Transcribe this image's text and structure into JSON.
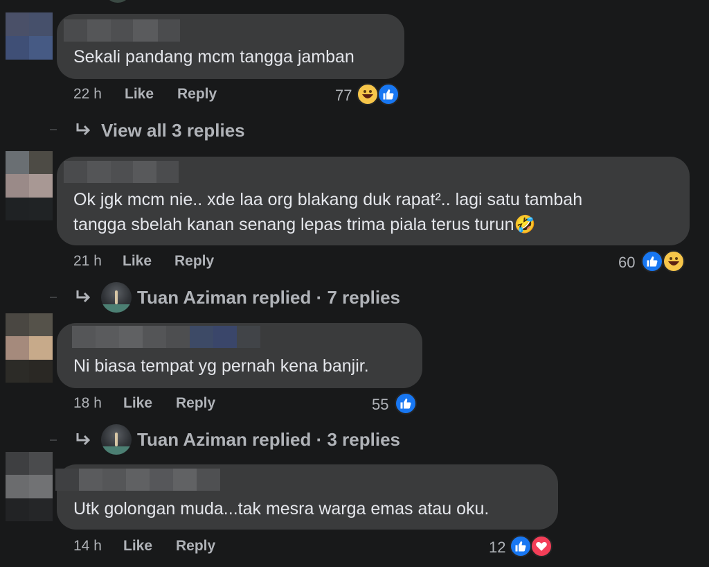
{
  "comments": [
    {
      "text_lines": [
        "Sekali pandang mcm tangga jamban"
      ],
      "time": "22 h",
      "like_label": "Like",
      "reply_label": "Reply",
      "reaction_count": "77",
      "reactions": [
        "haha",
        "like"
      ],
      "replies_text": "View all 3 replies"
    },
    {
      "text_lines": [
        "Ok jgk mcm nie.. xde laa org blakang duk rapat².. lagi satu tambah",
        "tangga sbelah kanan senang lepas trima piala terus turun🤣"
      ],
      "time": "21 h",
      "like_label": "Like",
      "reply_label": "Reply",
      "reaction_count": "60",
      "reactions": [
        "like",
        "haha"
      ],
      "replies_text": "Tuan Aziman replied · 7 replies"
    },
    {
      "text_lines": [
        "Ni biasa tempat yg pernah kena banjir."
      ],
      "time": "18 h",
      "like_label": "Like",
      "reply_label": "Reply",
      "reaction_count": "55",
      "reactions": [
        "like"
      ],
      "replies_text": "Tuan Aziman replied · 3 replies"
    },
    {
      "text_lines": [
        "Utk golongan muda...tak mesra warga emas atau oku."
      ],
      "time": "14 h",
      "like_label": "Like",
      "reply_label": "Reply",
      "reaction_count": "12",
      "reactions": [
        "like",
        "love"
      ]
    }
  ],
  "colors": {
    "background": "#18191a",
    "bubble": "#3a3b3c",
    "meta_text": "#b0b3b8",
    "like_blue": "#1877f2",
    "love_red": "#f33e58",
    "haha_yellow": "#f7c64a"
  }
}
